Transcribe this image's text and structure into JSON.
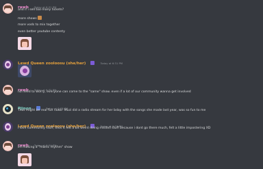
{
  "messages": [
    {
      "author": "rawb",
      "timestamp": "Today at 6:31 PM",
      "lines": [
        "and if i sell too many tickets?",
        "more shows",
        "more vods to mix together",
        "even better youtube contenty"
      ],
      "has_sticker": true
    },
    {
      "author": "Lewd Queen zooloosu (she/her)",
      "timestamp": "Today at 6:31 PM",
      "has_sticker": true
    },
    {
      "author": "rawb",
      "timestamp": "Today at 6:32 PM",
      "lines": [
        "no need to worry, everyone can come to the \"same\" show. even if a lot of our community wanna get involved"
      ]
    },
    {
      "author": "Pjinon",
      "timestamp": "Today at 6:33 PM",
      "lines": [
        "That might be real fun rawb! Muzi did a radio stream for her bday with the songs she made last year, was so fun to me"
      ]
    },
    {
      "author": "Lewd Queen zooloosu (she/her)",
      "timestamp": "Today at 6:33 PM",
      "lines": [
        "I love community stuff, thos it felt a bit weird doing misdvil stuff because i dont go there much, felt a little impostering XD"
      ]
    },
    {
      "author": "rawb",
      "timestamp": "Today at 6:34 PM",
      "lines": [
        "im making a \"manic rhythm\" show"
      ],
      "has_sticker": true
    }
  ],
  "colors": {
    "background": "#36393f",
    "text": "#dcddde",
    "timestamp": "#8e9297",
    "rawb": "#e88acb",
    "lewd_queen": "#e8a23c",
    "pjinon": "#7ed3c5"
  }
}
